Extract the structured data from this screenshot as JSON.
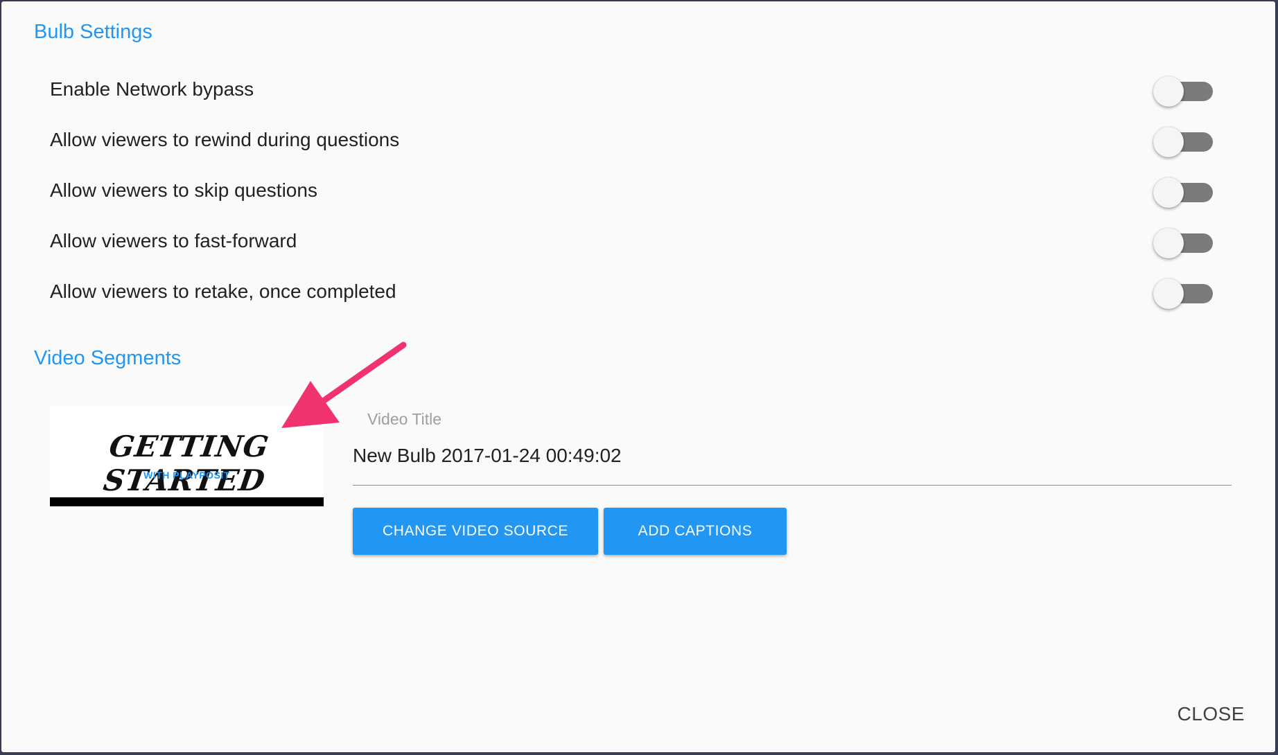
{
  "bulb_settings": {
    "title": "Bulb Settings",
    "options": [
      {
        "label": "Enable Network bypass",
        "enabled": false
      },
      {
        "label": "Allow viewers to rewind during questions",
        "enabled": false
      },
      {
        "label": "Allow viewers to skip questions",
        "enabled": false
      },
      {
        "label": "Allow viewers to fast-forward",
        "enabled": false
      },
      {
        "label": "Allow viewers to retake, once completed",
        "enabled": false
      }
    ]
  },
  "video_segments": {
    "title": "Video Segments",
    "thumbnail": {
      "title": "GETTING STARTED",
      "subtitle": "WITH PLAYPOSIT"
    },
    "video_title_label": "Video Title",
    "video_title_value": "New Bulb 2017-01-24 00:49:02",
    "change_source_label": "CHANGE VIDEO SOURCE",
    "add_captions_label": "ADD CAPTIONS"
  },
  "close_label": "CLOSE",
  "colors": {
    "accent": "#2196f3",
    "annotation_arrow": "#f0336f",
    "toggle_track": "#7b7b7b"
  },
  "icons": {
    "annotation": "arrow-pointer-icon"
  }
}
